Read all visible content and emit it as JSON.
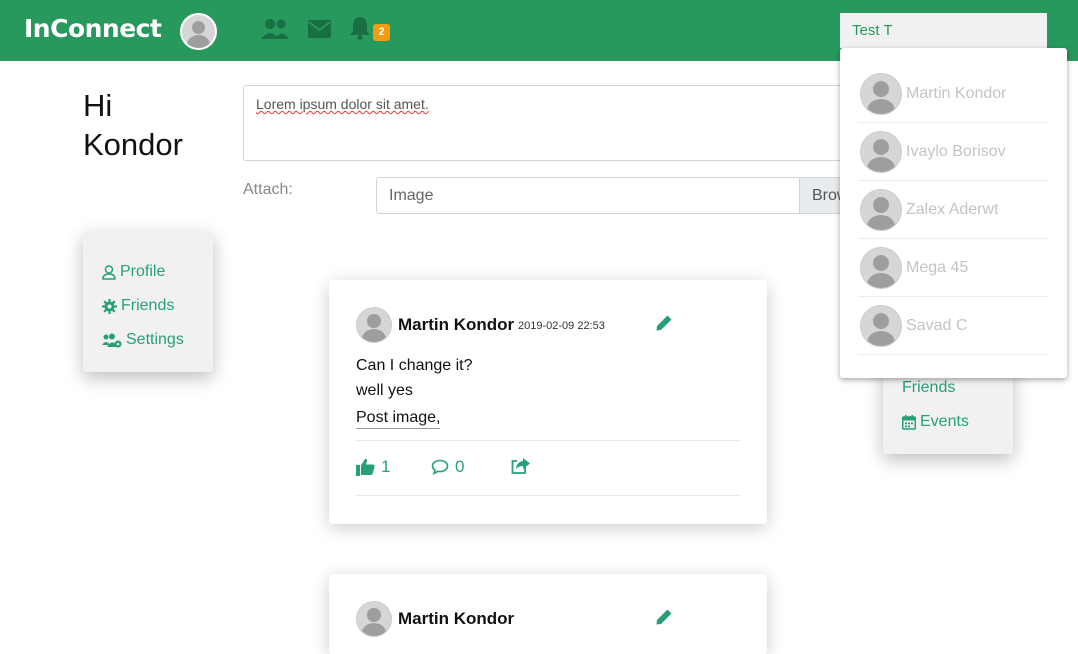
{
  "navbar": {
    "brand": "InConnect",
    "notification_count": "2",
    "search_value": "Test T",
    "icons": [
      "users-icon",
      "envelope-icon",
      "bell-icon"
    ]
  },
  "search_results": [
    {
      "name": "Martin Kondor"
    },
    {
      "name": "Ivaylo Borisov"
    },
    {
      "name": "Zalex Aderwt"
    },
    {
      "name": "Mega 45"
    },
    {
      "name": "Savad C"
    }
  ],
  "greeting": {
    "line1": "Hi",
    "line2": "Kondor"
  },
  "composer": {
    "text": "Lorem ipsum dolor sit amet.",
    "attach_label": "Attach:",
    "file_placeholder": "Image",
    "browse_label": "Browse"
  },
  "left_menu": [
    "Profile",
    "Friends",
    "Settings"
  ],
  "right_menu": [
    "Friends",
    "Events"
  ],
  "post": {
    "author": "Martin Kondor",
    "timestamp": "2019-02-09 22:53",
    "lines": [
      "Can I change it?",
      "well yes",
      "Post image,"
    ],
    "likes": "1",
    "comments": "0"
  },
  "post2": {
    "author": "Martin Kondor"
  },
  "colors": {
    "primary": "#27995c",
    "accent": "#27a07a",
    "badge": "#f39c12"
  }
}
